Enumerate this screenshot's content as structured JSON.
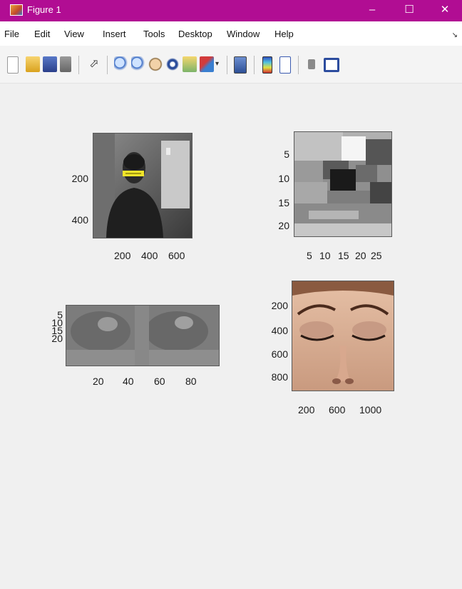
{
  "window": {
    "title": "Figure 1",
    "controls": [
      "–",
      "☐",
      "✕"
    ]
  },
  "menu": [
    "File",
    "Edit",
    "View",
    "Insert",
    "Tools",
    "Desktop",
    "Window",
    "Help"
  ],
  "toolbar": {
    "buttons": [
      "new-figure",
      "open-file",
      "save",
      "print",
      "edit-plot",
      "zoom-in",
      "zoom-out",
      "pan",
      "rotate-3d",
      "data-cursor",
      "brush",
      "link-plot",
      "colorbar",
      "legend",
      "hide-plot-tools",
      "show-plot-tools"
    ]
  },
  "subplots": {
    "face": {
      "xticks": [
        "200",
        "400",
        "600"
      ],
      "yticks": [
        "200",
        "400"
      ]
    },
    "eye_zoom": {
      "xticks": [
        "5",
        "10",
        "15",
        "20",
        "25"
      ],
      "yticks": [
        "5",
        "10",
        "15",
        "20"
      ]
    },
    "eye_strip": {
      "xticks": [
        "20",
        "40",
        "60",
        "80"
      ],
      "yticks": [
        "5",
        "10",
        "15",
        "20"
      ]
    },
    "closed_eyes": {
      "xticks": [
        "200",
        "600",
        "1000"
      ],
      "yticks": [
        "200",
        "400",
        "600",
        "800"
      ]
    }
  }
}
